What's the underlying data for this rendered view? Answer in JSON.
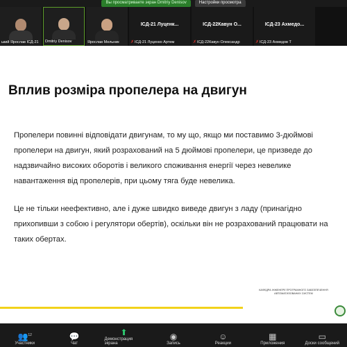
{
  "share_banner": {
    "status": "Вы просматриваете экран Dmitriy Denisov",
    "options_label": "Настройки просмотра"
  },
  "participants": [
    {
      "name": "ький Ярослав ІСД-21",
      "video": true
    },
    {
      "name": "Dmitriy Denisov",
      "video": true,
      "active": true
    },
    {
      "name": "Ярослав Мельник",
      "video": true
    },
    {
      "big_label": "ІСД-21  Луценк...",
      "name": "ІСД-21 Луценко Артем",
      "muted": true
    },
    {
      "big_label": "ІСД-22Кавун  О...",
      "name": "ІСД-22Кавун Олександр",
      "muted": true
    },
    {
      "big_label": "ІСД-23  Ахмедо...",
      "name": "ІСД-23 Ахмедов Т",
      "muted": true
    }
  ],
  "slide": {
    "title": "Вплив розміра пропелера на двигун",
    "paragraphs": [
      "Пропелери повинні відповідати двигунам, то му що, якщо ми поставимо 3-дюймові пропелери на двигун, який розрахований на 5 дюймові пропелери, це призведе до надзвичайно високих оборотів і великого споживання енергії через невелике навантаження від пропелерів, при цьому тяга буде невелика.",
      "Це не тільки неефективно, але і дуже швидко виведе двигун з ладу (принагідно прихопивши з собою і регулятори обертів), оскільки він не розрахований працювати на таких обертах."
    ],
    "dept_text": "КАФЕДРА ІНЖЕНЕРІЇ ПРОГРАМНОГО ЗАБЕЗПЕЧЕННЯ АВТОМАТИЗОВАНИХ СИСТЕМ"
  },
  "toolbar": {
    "participants_label": "Участники",
    "participants_count": "12",
    "chat_label": "Чат",
    "share_label": "Демонстрация экрана",
    "record_label": "Запись",
    "reactions_label": "Реакции",
    "apps_label": "Приложения",
    "whiteboard_label": "Доски сообщений"
  },
  "colors": {
    "accent_green": "#2ecc71",
    "footer_yellow": "#f2d21b",
    "muted_red": "#e0342c"
  }
}
